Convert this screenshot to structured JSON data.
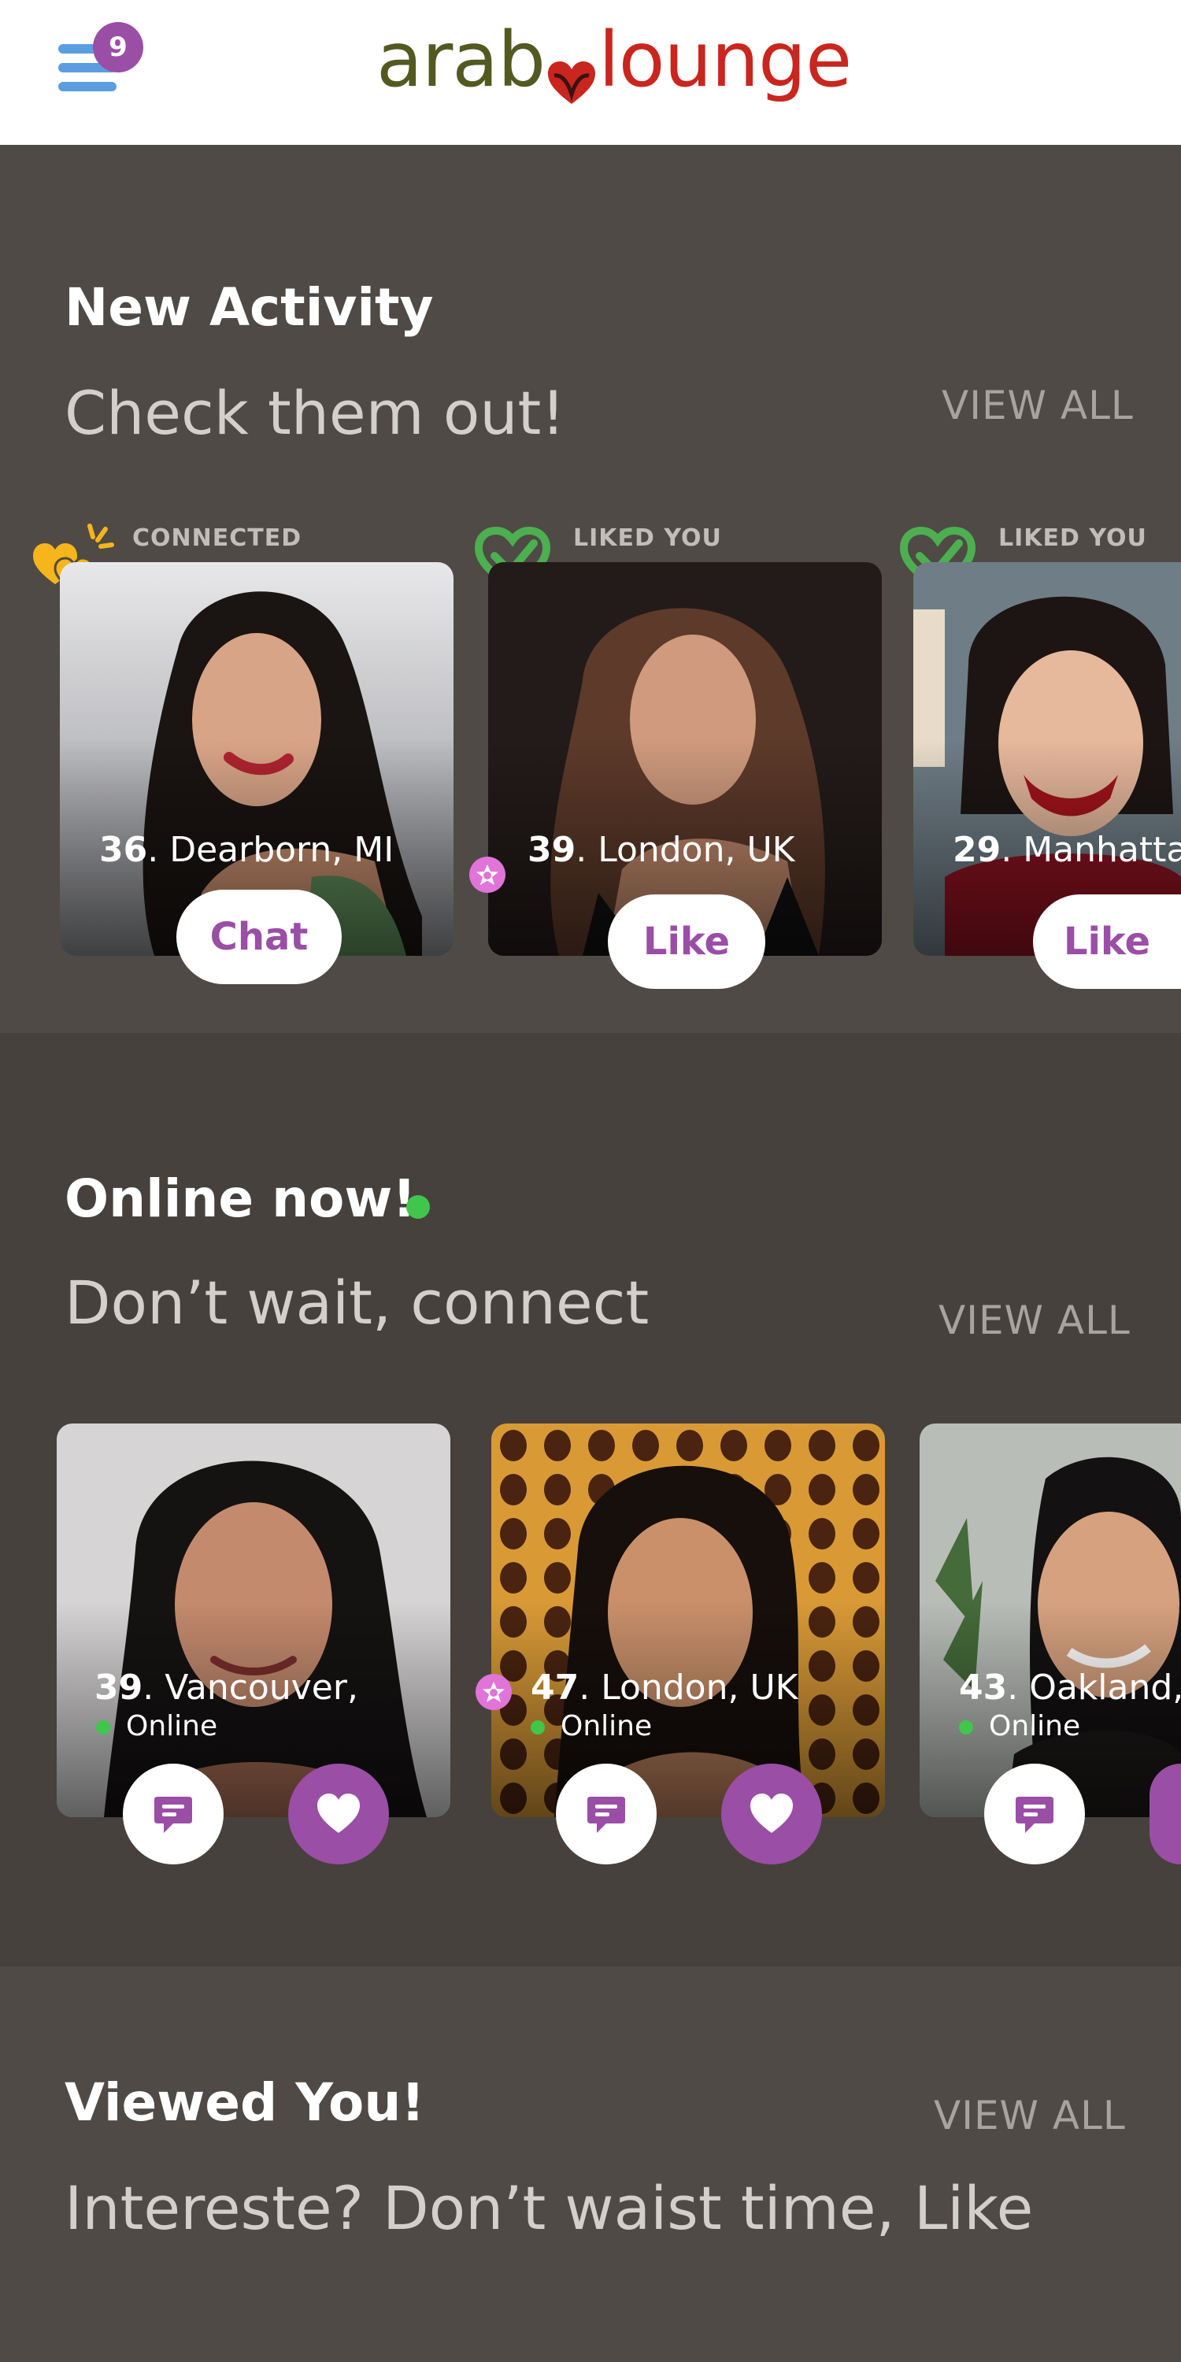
{
  "header": {
    "menu_badge_count": "9",
    "logo_left": "arab",
    "logo_right": "lounge",
    "colors": {
      "logo_left": "#525a21",
      "logo_right": "#c9261e",
      "menu": "#5b9ee0",
      "badge": "#9a4ea6"
    }
  },
  "new_activity": {
    "title": "New Activity",
    "subtitle": "Check them out!",
    "view_all": "VIEW ALL",
    "cards": [
      {
        "status": "CONNECTED",
        "status_icon": "hearts-icon",
        "age": "36",
        "location": ". Dearborn, MI",
        "button": "Chat",
        "premium": false
      },
      {
        "status": "LIKED YOU",
        "status_icon": "heart-check-icon",
        "age": "39",
        "location": ". London, UK",
        "button": "Like",
        "premium": true
      },
      {
        "status": "LIKED YOU",
        "status_icon": "heart-check-icon",
        "age": "29",
        "location": ". Manhattan",
        "button": "Like",
        "premium": false
      }
    ]
  },
  "online_now": {
    "title": "Online now!",
    "subtitle": "Don’t wait, connect",
    "view_all": "VIEW ALL",
    "cards": [
      {
        "age": "39",
        "location": ". Vancouver,",
        "status": "Online",
        "premium": false
      },
      {
        "age": "47",
        "location": ". London, UK",
        "status": "Online",
        "premium": true
      },
      {
        "age": "43",
        "location": ". Oakland,",
        "status": "Online",
        "premium": false
      }
    ]
  },
  "viewed_you": {
    "title": "Viewed You!",
    "subtitle": "Intereste? Don’t waist time, Like",
    "view_all": "VIEW ALL"
  },
  "colors": {
    "accent": "#9a4ea6",
    "online": "#3fc64b",
    "liked": "#4caf50",
    "connected": "#f5b51b"
  }
}
